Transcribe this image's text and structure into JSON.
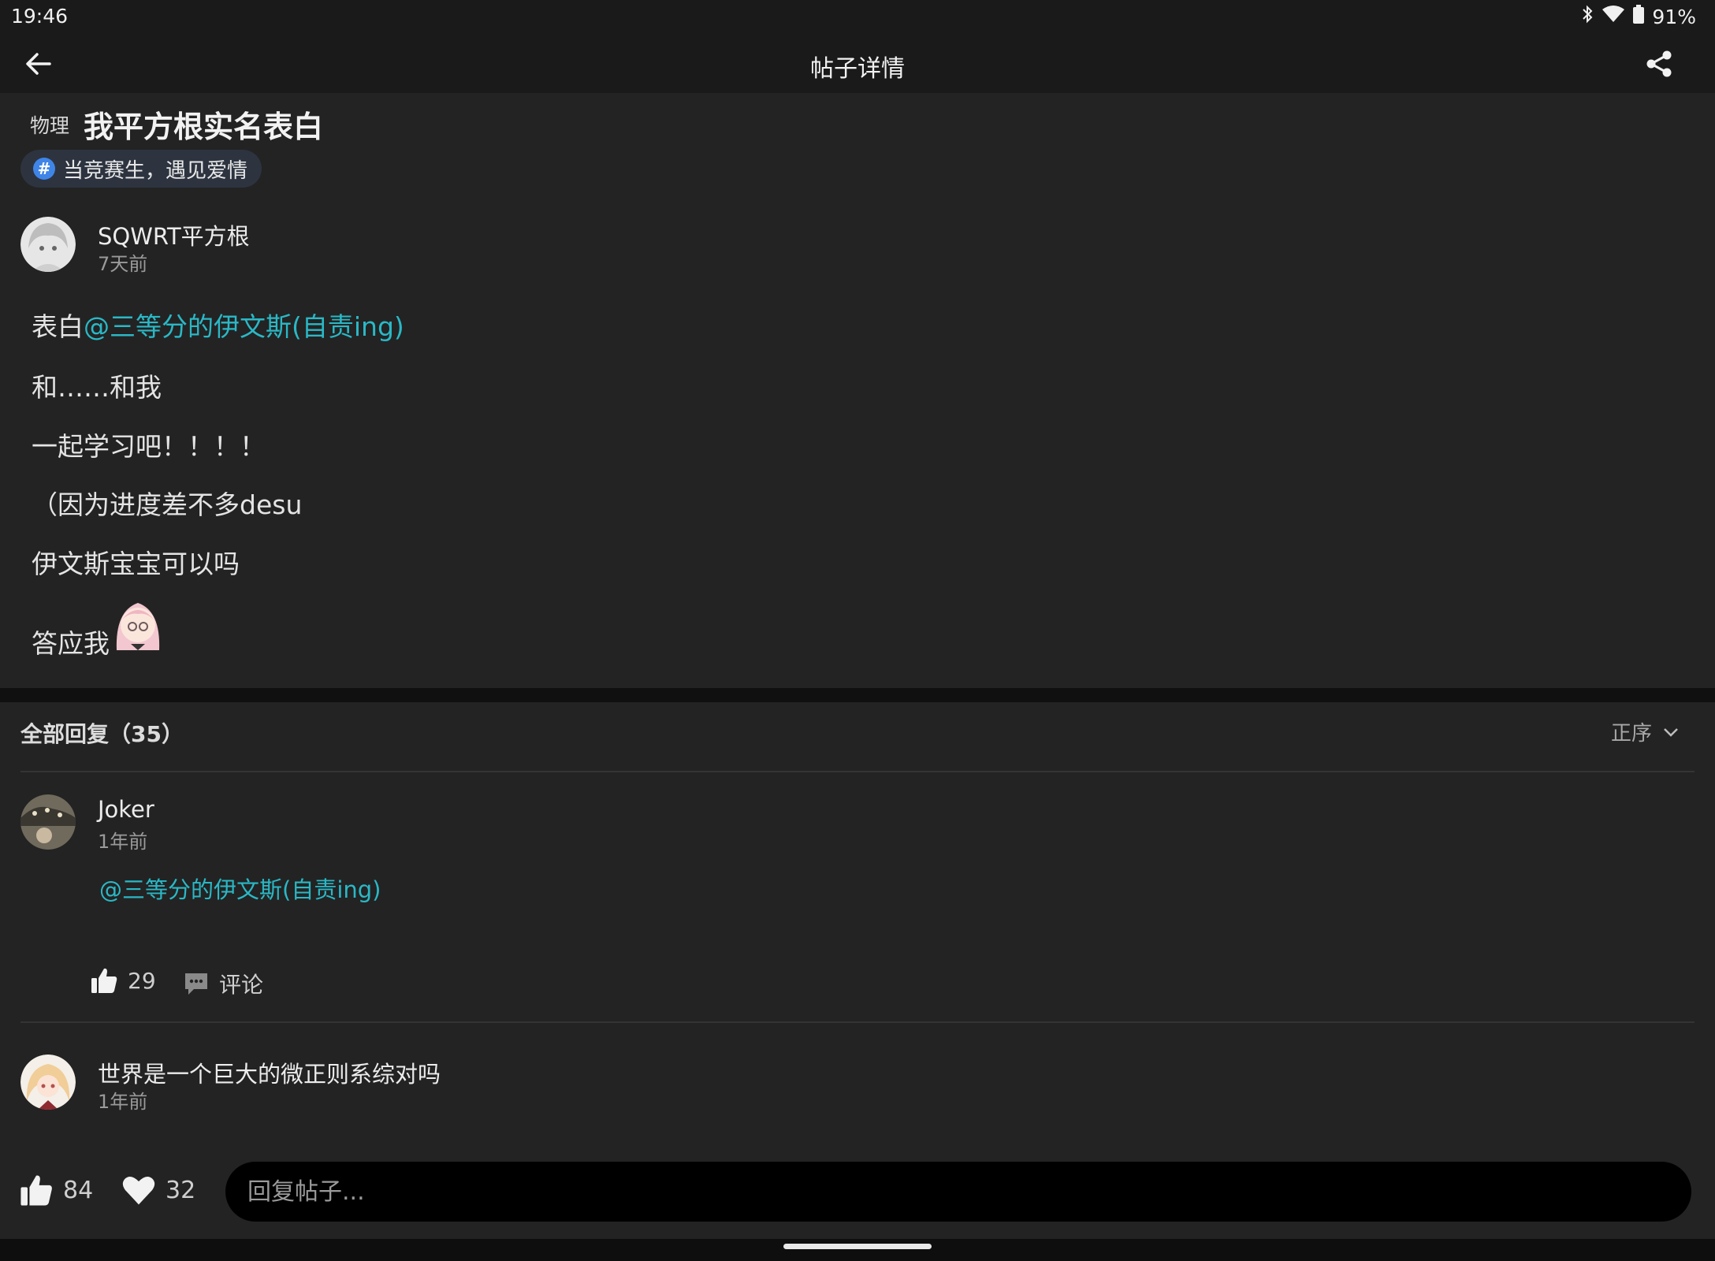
{
  "status_bar": {
    "time": "19:46",
    "battery": "91%",
    "icons": [
      "bluetooth-icon",
      "wifi-icon",
      "battery-icon"
    ]
  },
  "app_bar": {
    "title": "帖子详情",
    "back_icon": "arrow-left-icon",
    "share_icon": "share-icon"
  },
  "post": {
    "subject": "物理",
    "title": "我平方根实名表白",
    "topic": "当竞赛生，遇见爱情",
    "author": "SQWRT平方根",
    "time": "7天前",
    "line1_prefix": "表白",
    "line1_mention": "@三等分的伊文斯(自责ing)",
    "line2": "和……和我",
    "line3": "一起学习吧！！！！",
    "line4": "（因为进度差不多desu",
    "line5": "伊文斯宝宝可以吗",
    "line6": "答应我"
  },
  "replies": {
    "header": "全部回复（35）",
    "sort_label": "正序",
    "items": [
      {
        "author": "Joker",
        "time": "1年前",
        "mention": "@三等分的伊文斯(自责ing)",
        "likes": "29",
        "comment_label": "评论"
      },
      {
        "author": "世界是一个巨大的微正则系综对吗",
        "time": "1年前"
      }
    ]
  },
  "bottom_bar": {
    "likes": "84",
    "favorites": "32",
    "reply_placeholder": "回复帖子..."
  },
  "colors": {
    "background": "#232323",
    "bar": "#1a1a1a",
    "mention": "#2ab8c6",
    "topic_hash": "#3f85e8"
  }
}
